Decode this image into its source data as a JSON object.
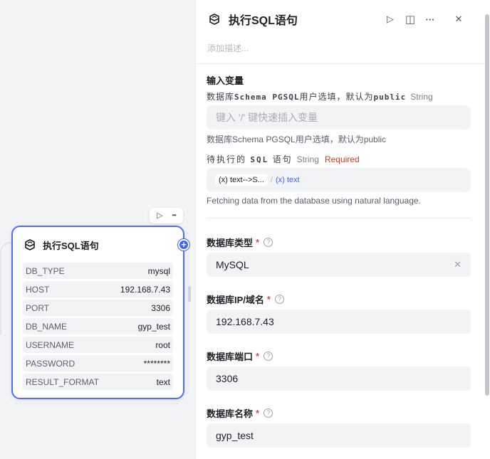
{
  "node": {
    "title": "执行SQL语句",
    "rows": [
      {
        "key": "DB_TYPE",
        "value": "mysql"
      },
      {
        "key": "HOST",
        "value": "192.168.7.43"
      },
      {
        "key": "PORT",
        "value": "3306"
      },
      {
        "key": "DB_NAME",
        "value": "gyp_test"
      },
      {
        "key": "USERNAME",
        "value": "root"
      },
      {
        "key": "PASSWORD",
        "value": "********"
      },
      {
        "key": "RESULT_FORMAT",
        "value": "text"
      }
    ],
    "port_label": "+",
    "toolbar": {
      "run_icon": "▷",
      "more_icon": "•••"
    }
  },
  "panel": {
    "title": "执行SQL语句",
    "description_placeholder": "添加描述...",
    "actions": {
      "run_icon": "▷",
      "split_icon": "◫",
      "more_icon": "···",
      "close_icon": "✕"
    },
    "inputs_section": {
      "title": "输入变量",
      "schema_param": {
        "prefix": "数据库",
        "name": "Schema PGSQL",
        "suffix": "用户选填，默认为",
        "default": "public",
        "type": "String"
      },
      "schema_input_placeholder": "键入 '/' 键快速插入变量",
      "schema_hint": "数据库Schema PGSQL用户选填，默认为public",
      "sql_param": {
        "prefix": "待执行的",
        "name": "SQL",
        "suffix": "语句",
        "type": "String",
        "required": "Required"
      },
      "sql_tag_node": "(x) text-->S...",
      "sql_tag_sep": "/",
      "sql_tag_var": "(x) text",
      "sql_hint": "Fetching data from the database using natural language."
    },
    "fields": {
      "db_type": {
        "label": "数据库类型",
        "star": "*",
        "value": "MySQL",
        "clear_icon": "✕"
      },
      "db_host": {
        "label": "数据库IP/域名",
        "star": "*",
        "value": "192.168.7.43"
      },
      "db_port": {
        "label": "数据库端口",
        "star": "*",
        "value": "3306"
      },
      "db_name": {
        "label": "数据库名称",
        "star": "*",
        "value": "gyp_test"
      }
    },
    "help_icon": "?"
  }
}
